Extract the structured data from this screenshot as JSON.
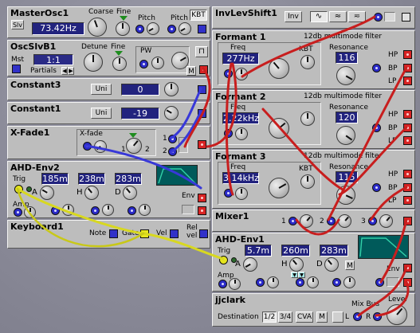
{
  "modules": {
    "masterosc1": {
      "title": "MasterOsc1",
      "coarse": "Coarse",
      "fine": "Fine",
      "pitch1": "Pitch",
      "pitch2": "Pitch",
      "kbt": "KBT",
      "slv": "Slv",
      "freq": "73.42Hz"
    },
    "oscslvb1": {
      "title": "OscSlvB1",
      "detune": "Detune",
      "fine": "Fine",
      "pw": "PW",
      "mst": "Mst",
      "ratio": "1:1",
      "partials": "Partials",
      "m": "M"
    },
    "constant3": {
      "title": "Constant3",
      "uni": "Uni",
      "value": "0"
    },
    "constant1": {
      "title": "Constant1",
      "uni": "Uni",
      "value": "-19"
    },
    "xfade1": {
      "title": "X-Fade1",
      "xfade": "X-fade",
      "n1": "1",
      "n2": "2",
      "p1": "1",
      "p2": "2"
    },
    "ahdenv2": {
      "title": "AHD-Env2",
      "trig": "Trig",
      "a_val": "185m",
      "h_val": "238m",
      "d_val": "283m",
      "a": "A",
      "h": "H",
      "d": "D",
      "amp": "Amp",
      "env": "Env"
    },
    "keyboard1": {
      "title": "Keyboard1",
      "note": "Note",
      "gate": "Gate",
      "vel": "Vel",
      "rel": "Rel",
      "vel2": "vel"
    },
    "invlevshift1": {
      "title": "InvLevShift1",
      "inv": "Inv"
    },
    "formant1": {
      "title": "Formant 1",
      "type": "12db multimode filter",
      "freq_label": "Freq",
      "freq": "277Hz",
      "kbt": "KBT",
      "res_label": "Resonance",
      "res": "116",
      "hp": "HP",
      "bp": "BP",
      "lp": "LP"
    },
    "formant2": {
      "title": "Formant 2",
      "type": "12db multimode filter",
      "freq_label": "Freq",
      "freq": "2.22kHz",
      "res_label": "Resonance",
      "res": "120",
      "hp": "HP",
      "bp": "BP",
      "lp": "LP"
    },
    "formant3": {
      "title": "Formant 3",
      "type": "12db multimode filter",
      "freq_label": "Freq",
      "freq": "3.14kHz",
      "kbt": "KBT",
      "res_label": "Resonance",
      "res": "115",
      "hp": "HP",
      "bp": "BP",
      "lp": "LP"
    },
    "mixer1": {
      "title": "Mixer1",
      "c1": "1",
      "c2": "2",
      "c3": "3"
    },
    "ahdenv1": {
      "title": "AHD-Env1",
      "trig": "Trig",
      "a_val": "5.7m",
      "h_val": "260m",
      "d_val": "283m",
      "a": "A",
      "h": "H",
      "d": "D",
      "m": "M",
      "amp": "Amp",
      "env": "Env"
    },
    "jjclark": {
      "title": "jjclark",
      "destination": "Destination",
      "d12": "1/2",
      "d34": "3/4",
      "cva": "CVA",
      "m": "M",
      "mixbus": "Mix Bus",
      "level": "Level",
      "l": "L",
      "r": "R"
    }
  },
  "colors": {
    "cable_red": "#c81e1e",
    "cable_blue": "#3838d8",
    "cable_yellow": "#d8d820",
    "display_bg": "#22237e",
    "panel": "#bdbdbd"
  }
}
